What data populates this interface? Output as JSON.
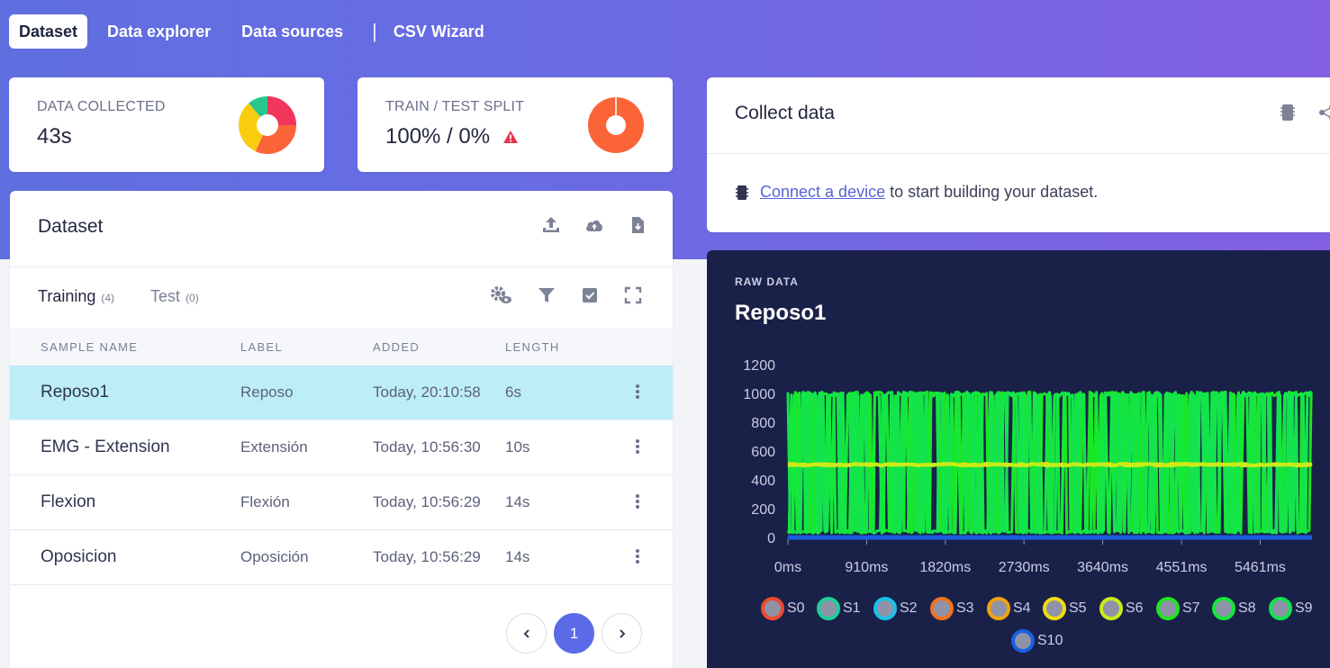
{
  "nav": {
    "tabs": [
      "Dataset",
      "Data explorer",
      "Data sources",
      "CSV Wizard"
    ],
    "separator": "|"
  },
  "stats": {
    "collected": {
      "label": "DATA COLLECTED",
      "value": "43s"
    },
    "split": {
      "label": "TRAIN / TEST SPLIT",
      "value": "100% / 0%"
    }
  },
  "dataset": {
    "title": "Dataset",
    "tabs": [
      {
        "label": "Training",
        "count": "(4)"
      },
      {
        "label": "Test",
        "count": "(0)"
      }
    ],
    "columns": [
      "SAMPLE NAME",
      "LABEL",
      "ADDED",
      "LENGTH"
    ],
    "rows": [
      {
        "name": "Reposo1",
        "label": "Reposo",
        "added": "Today, 20:10:58",
        "length": "6s"
      },
      {
        "name": "EMG - Extension",
        "label": "Extensión",
        "added": "Today, 10:56:30",
        "length": "10s"
      },
      {
        "name": "Flexion",
        "label": "Flexión",
        "added": "Today, 10:56:29",
        "length": "14s"
      },
      {
        "name": "Oposicion",
        "label": "Oposición",
        "added": "Today, 10:56:29",
        "length": "14s"
      }
    ],
    "page": "1"
  },
  "collect": {
    "title": "Collect data",
    "link": "Connect a device",
    "message": "to start building your dataset."
  },
  "raw": {
    "kicker": "RAW DATA",
    "title": "Reposo1"
  },
  "colors": {
    "accent": "#5b6be8",
    "selected_row": "#bdeef8",
    "warning": "#e6344a"
  },
  "chart_data": {
    "type": "line",
    "x_unit": "ms",
    "x_ticks": [
      "0ms",
      "910ms",
      "1820ms",
      "2730ms",
      "3640ms",
      "4551ms",
      "5461ms"
    ],
    "x_tick_values": [
      0,
      910,
      1820,
      2730,
      3640,
      4551,
      5461
    ],
    "xlim": [
      0,
      6060
    ],
    "y_ticks": [
      "0",
      "200",
      "400",
      "600",
      "800",
      "1000",
      "1200"
    ],
    "ylim": [
      0,
      1200
    ],
    "legend_position": "bottom",
    "series": [
      {
        "name": "S0",
        "color": "#ef4a2f",
        "level": 0
      },
      {
        "name": "S1",
        "color": "#1fcf9a",
        "level": 0
      },
      {
        "name": "S2",
        "color": "#19c1ea",
        "level": 0
      },
      {
        "name": "S3",
        "color": "#f0731d",
        "level": 0
      },
      {
        "name": "S4",
        "color": "#f2a20c",
        "level": 0
      },
      {
        "name": "S5",
        "color": "#f1dc0d",
        "level": 505
      },
      {
        "name": "S6",
        "color": "#c8ec18",
        "level": 505
      },
      {
        "name": "S7",
        "color": "#1ee51e",
        "level": "square"
      },
      {
        "name": "S8",
        "color": "#14e83a",
        "level": "square"
      },
      {
        "name": "S9",
        "color": "#13e34e",
        "level": "square"
      },
      {
        "name": "S10",
        "color": "#1b5fe0",
        "level": 0
      }
    ],
    "square_wave_range": [
      30,
      1010
    ]
  }
}
